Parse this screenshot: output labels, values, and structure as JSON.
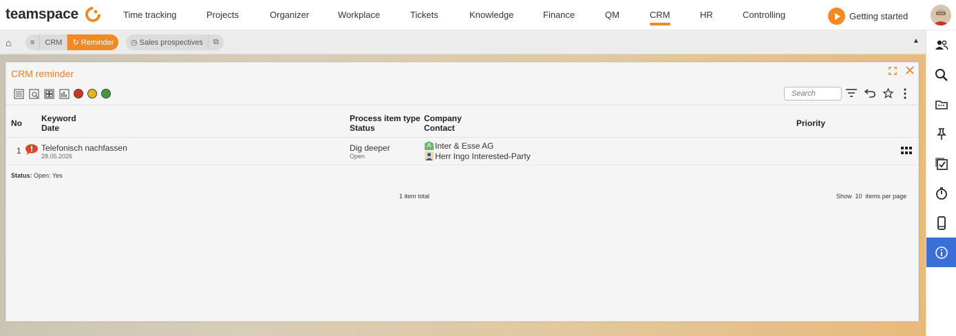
{
  "brand": {
    "name": "teamspace"
  },
  "nav": {
    "items": [
      "Time tracking",
      "Projects",
      "Organizer",
      "Workplace",
      "Tickets",
      "Knowledge",
      "Finance",
      "QM",
      "CRM",
      "HR",
      "Controlling"
    ],
    "active": "CRM",
    "getting_started": "Getting started"
  },
  "breadcrumbs": {
    "menu_icon": "≡",
    "crm": "CRM",
    "reminder": "Reminder",
    "sales": "Sales prospectives"
  },
  "panel": {
    "title": "CRM reminder",
    "search_placeholder": "Search",
    "columns": {
      "no": "No",
      "keyword": "Keyword",
      "date": "Date",
      "process_type": "Process item type",
      "status": "Status",
      "company": "Company",
      "contact": "Contact",
      "priority": "Priority"
    },
    "rows": [
      {
        "no": "1",
        "keyword": "Telefonisch nachfassen",
        "date": "28.05.2026",
        "process_type": "Dig deeper",
        "status": "Open",
        "company": "Inter & Esse AG",
        "contact": "Herr Ingo Interested-Party",
        "company_badge": "A"
      }
    ],
    "status_label": "Status:",
    "status_value": "Open: Yes",
    "total": "1 item total",
    "show_label": "Show",
    "show_count": "10",
    "per_page": "items per page"
  },
  "colors": {
    "accent": "#f08a24",
    "sidebar_active": "#3a6fd8",
    "status_red": "#c8391f",
    "status_yellow": "#e3b51c",
    "status_green": "#3d9a3d"
  },
  "icons": {
    "sidebar": [
      "people-icon",
      "search-icon",
      "folder-icon",
      "pin-icon",
      "task-icon",
      "stopwatch-icon",
      "mobile-icon",
      "info-icon"
    ]
  }
}
